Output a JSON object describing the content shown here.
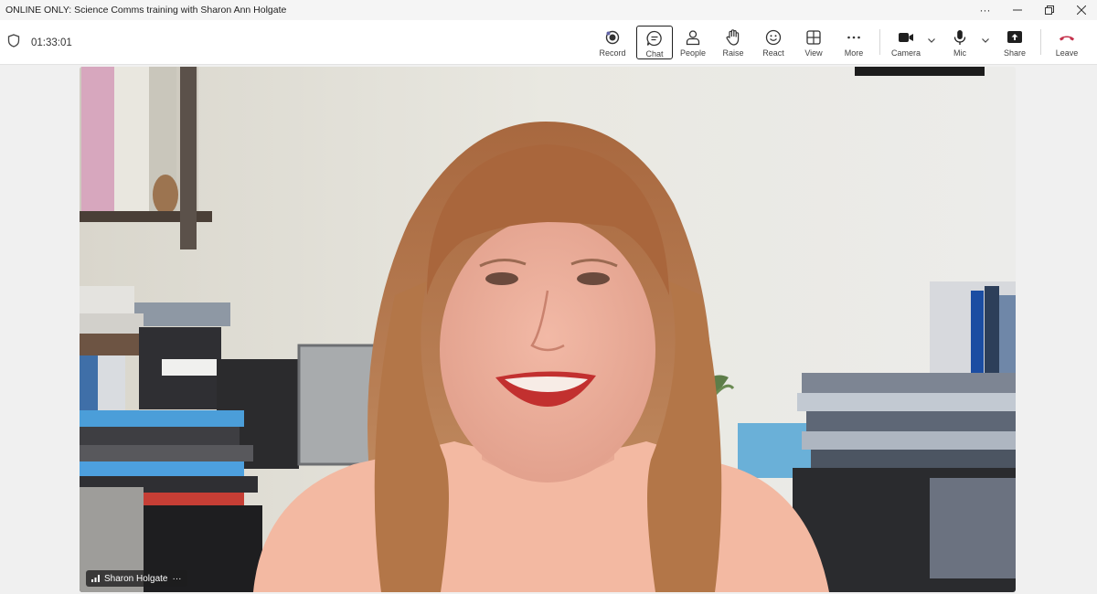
{
  "window": {
    "title": "ONLINE ONLY: Science Comms training with Sharon Ann Holgate",
    "controls": [
      "more-icon",
      "minimize-icon",
      "restore-icon",
      "close-icon"
    ]
  },
  "meeting": {
    "elapsed": "01:33:01"
  },
  "toolbar": {
    "record": "Record",
    "chat": "Chat",
    "people": "People",
    "raise": "Raise",
    "react": "React",
    "view": "View",
    "more": "More",
    "camera": "Camera",
    "mic": "Mic",
    "share": "Share",
    "leave": "Leave"
  },
  "participant": {
    "name": "Sharon Holgate",
    "menu": "···"
  },
  "colors": {
    "leave": "#c4314b",
    "record_dot": "#6264a7",
    "toolbar_bg": "#ffffff",
    "stage_bg": "#f0f0f0"
  }
}
